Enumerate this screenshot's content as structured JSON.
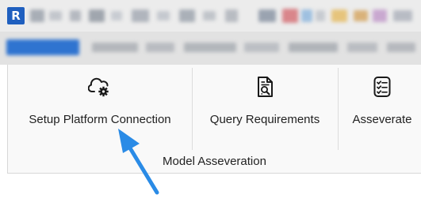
{
  "app": {
    "logo_letter": "R"
  },
  "ribbon": {
    "buttons": [
      {
        "label": "Setup Platform Connection",
        "icon": "cloud-gear-icon"
      },
      {
        "label": "Query Requirements",
        "icon": "document-search-icon"
      },
      {
        "label": "Asseverate",
        "icon": "checklist-icon"
      }
    ],
    "group_label": "Model Asseveration"
  },
  "annotation": {
    "arrow_color": "#2a8be6"
  }
}
